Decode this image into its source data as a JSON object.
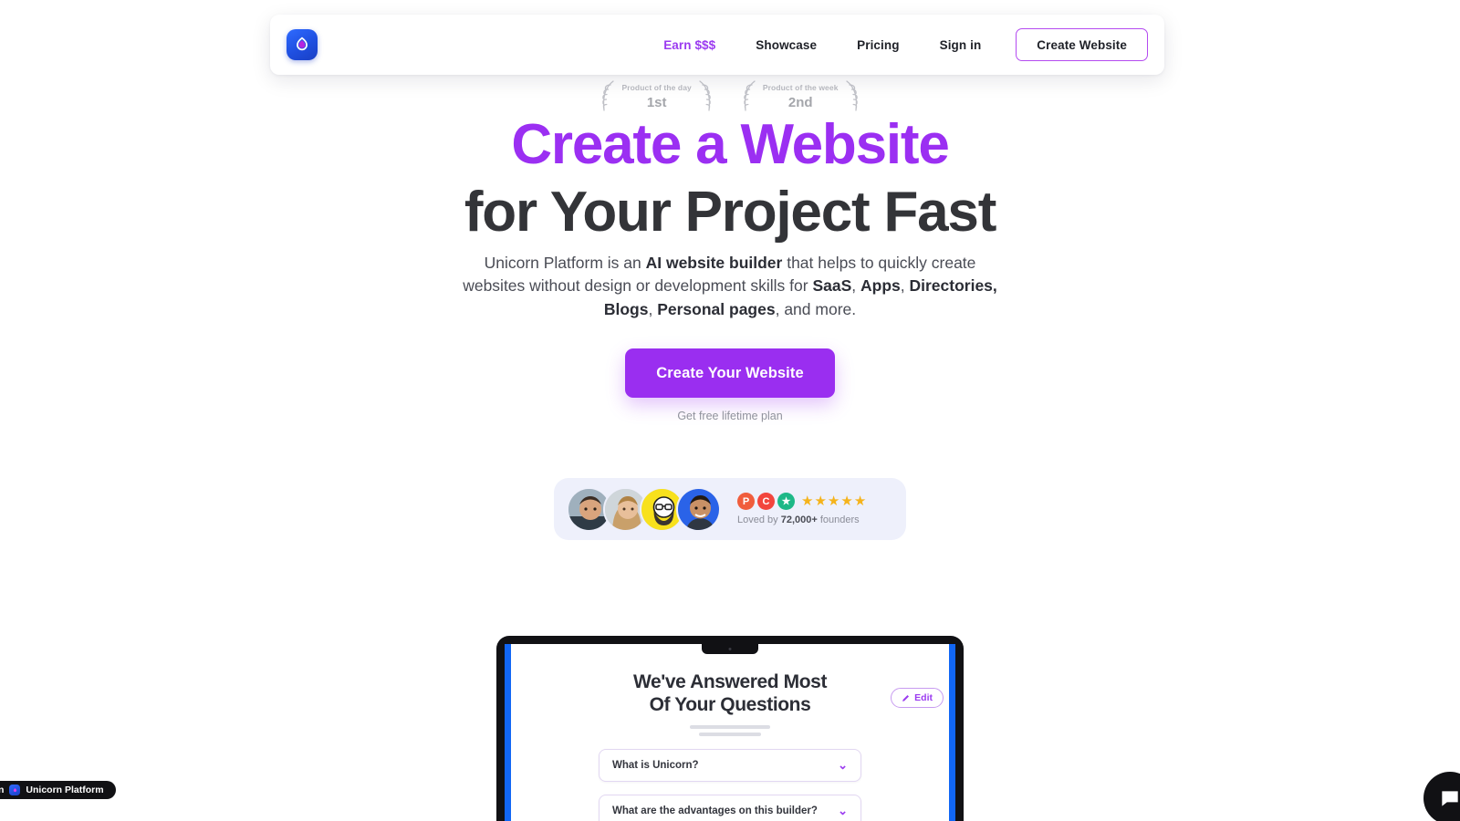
{
  "header": {
    "logo_icon": "unicorn-drop-logo",
    "nav": [
      {
        "label": "Earn $$$",
        "accent": true
      },
      {
        "label": "Showcase",
        "accent": false
      },
      {
        "label": "Pricing",
        "accent": false
      },
      {
        "label": "Sign in",
        "accent": false
      }
    ],
    "cta_label": "Create Website"
  },
  "awards": [
    {
      "label": "Product of the day",
      "rank": "1st"
    },
    {
      "label": "Product of the week",
      "rank": "2nd"
    }
  ],
  "hero": {
    "title_line1": "Create a Website",
    "title_line2": "for Your Project Fast",
    "subtitle_parts": [
      {
        "text": "Unicorn Platform is an ",
        "bold": false
      },
      {
        "text": "AI website builder",
        "bold": true
      },
      {
        "text": " that helps to quickly create websites without design or development skills for ",
        "bold": false
      },
      {
        "text": "SaaS",
        "bold": true
      },
      {
        "text": ", ",
        "bold": false
      },
      {
        "text": "Apps",
        "bold": true
      },
      {
        "text": ", ",
        "bold": false
      },
      {
        "text": "Directories, Blogs",
        "bold": true
      },
      {
        "text": ", ",
        "bold": false
      },
      {
        "text": "Personal pages",
        "bold": true
      },
      {
        "text": ", and more.",
        "bold": false
      }
    ],
    "cta_label": "Create Your Website",
    "cta_note": "Get free lifetime plan"
  },
  "social_proof": {
    "avatar_count": 4,
    "badges": [
      {
        "name": "product-hunt-badge",
        "glyph": "P",
        "color": "#f05d3c"
      },
      {
        "name": "capterra-badge",
        "glyph": "C",
        "color": "#f2453d"
      },
      {
        "name": "trustpilot-badge",
        "glyph": "★",
        "color": "#1db887"
      }
    ],
    "stars": 5,
    "loved_prefix": "Loved by ",
    "loved_count": "72,000+",
    "loved_suffix": " founders"
  },
  "mockup": {
    "faq_title_line1": "We've Answered Most",
    "faq_title_line2": "Of Your Questions",
    "edit_label": "Edit",
    "edit_icon": "pencil-icon",
    "items": [
      {
        "question": "What is Unicorn?"
      },
      {
        "question": "What are the advantages on this builder?"
      }
    ]
  },
  "widgets": {
    "made_with_prefix": "n",
    "made_with_label": "Unicorn Platform",
    "chat_icon": "chat-bubble-icon"
  },
  "colors": {
    "brand_purple": "#9a2ef0",
    "brand_blue": "#1166f5",
    "heading_dark": "#333438",
    "social_bg": "#eef0fb"
  }
}
